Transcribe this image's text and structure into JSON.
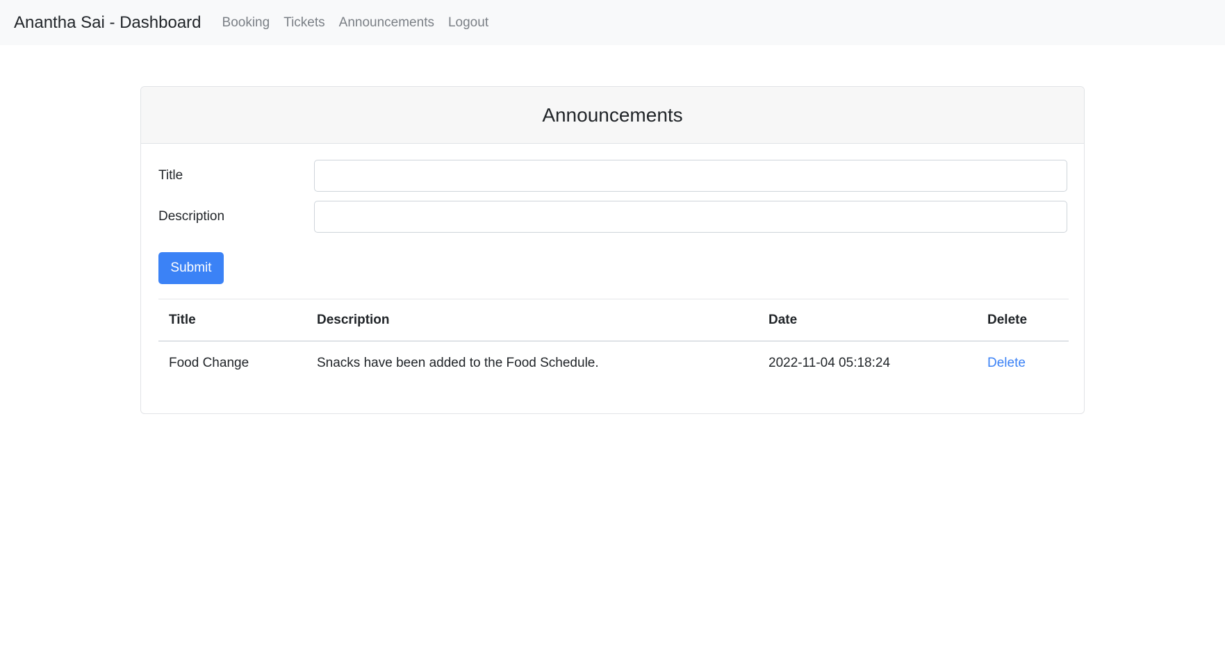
{
  "navbar": {
    "brand": "Anantha Sai - Dashboard",
    "links": [
      "Booking",
      "Tickets",
      "Announcements",
      "Logout"
    ]
  },
  "card": {
    "title": "Announcements"
  },
  "form": {
    "title_label": "Title",
    "title_value": "",
    "description_label": "Description",
    "description_value": "",
    "submit_label": "Submit"
  },
  "table": {
    "headers": [
      "Title",
      "Description",
      "Date",
      "Delete"
    ],
    "rows": [
      {
        "title": "Food Change",
        "description": "Snacks have been added to the Food Schedule.",
        "date": "2022-11-04 05:18:24",
        "delete_label": "Delete"
      }
    ]
  },
  "colors": {
    "primary": "#3b82f6",
    "navbar_bg": "#f8f9fa",
    "card_header_bg": "#f7f7f7"
  }
}
